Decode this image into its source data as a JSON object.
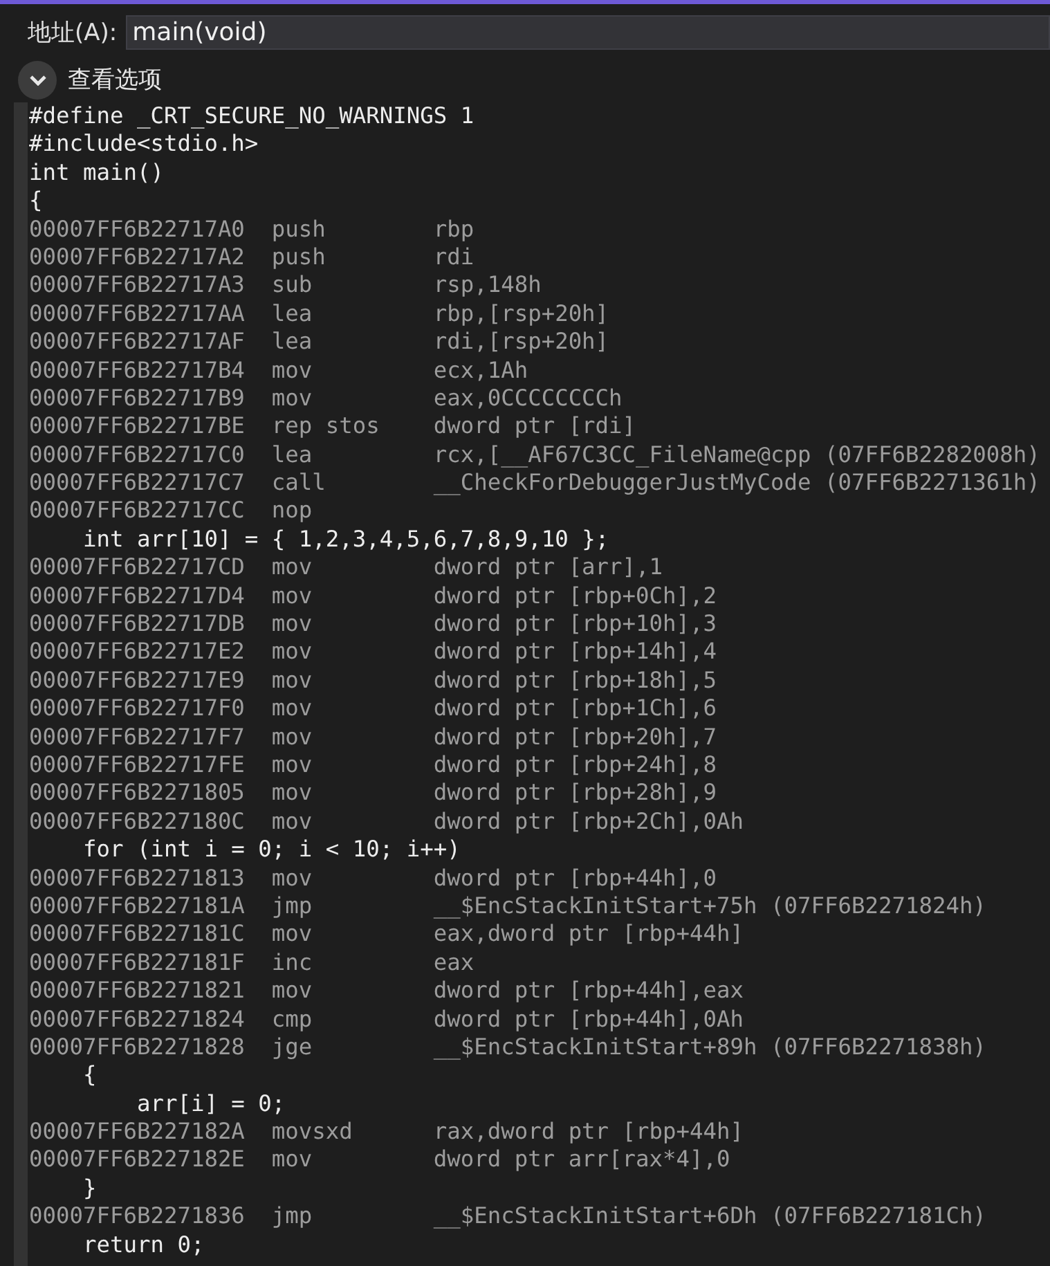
{
  "address_bar": {
    "label": "地址(A):",
    "value": "main(void)"
  },
  "view_options": {
    "label": "查看选项",
    "expanded": false
  },
  "lines": [
    {
      "kind": "source",
      "text": "#define _CRT_SECURE_NO_WARNINGS 1"
    },
    {
      "kind": "source",
      "text": "#include<stdio.h>"
    },
    {
      "kind": "source",
      "text": "int main()"
    },
    {
      "kind": "source",
      "text": "{"
    },
    {
      "kind": "asm",
      "address": "00007FF6B22717A0",
      "mnemonic": "push",
      "operands": "rbp"
    },
    {
      "kind": "asm",
      "address": "00007FF6B22717A2",
      "mnemonic": "push",
      "operands": "rdi"
    },
    {
      "kind": "asm",
      "address": "00007FF6B22717A3",
      "mnemonic": "sub",
      "operands": "rsp,148h"
    },
    {
      "kind": "asm",
      "address": "00007FF6B22717AA",
      "mnemonic": "lea",
      "operands": "rbp,[rsp+20h]"
    },
    {
      "kind": "asm",
      "address": "00007FF6B22717AF",
      "mnemonic": "lea",
      "operands": "rdi,[rsp+20h]"
    },
    {
      "kind": "asm",
      "address": "00007FF6B22717B4",
      "mnemonic": "mov",
      "operands": "ecx,1Ah"
    },
    {
      "kind": "asm",
      "address": "00007FF6B22717B9",
      "mnemonic": "mov",
      "operands": "eax,0CCCCCCCCh"
    },
    {
      "kind": "asm",
      "address": "00007FF6B22717BE",
      "mnemonic": "rep stos",
      "operands": "dword ptr [rdi]"
    },
    {
      "kind": "asm",
      "address": "00007FF6B22717C0",
      "mnemonic": "lea",
      "operands": "rcx,[__AF67C3CC_FileName@cpp (07FF6B2282008h)"
    },
    {
      "kind": "asm",
      "address": "00007FF6B22717C7",
      "mnemonic": "call",
      "operands": "__CheckForDebuggerJustMyCode (07FF6B2271361h)"
    },
    {
      "kind": "asm",
      "address": "00007FF6B22717CC",
      "mnemonic": "nop"
    },
    {
      "kind": "source",
      "text": "    int arr[10] = { 1,2,3,4,5,6,7,8,9,10 };"
    },
    {
      "kind": "asm",
      "address": "00007FF6B22717CD",
      "mnemonic": "mov",
      "operands": "dword ptr [arr],1"
    },
    {
      "kind": "asm",
      "address": "00007FF6B22717D4",
      "mnemonic": "mov",
      "operands": "dword ptr [rbp+0Ch],2"
    },
    {
      "kind": "asm",
      "address": "00007FF6B22717DB",
      "mnemonic": "mov",
      "operands": "dword ptr [rbp+10h],3"
    },
    {
      "kind": "asm",
      "address": "00007FF6B22717E2",
      "mnemonic": "mov",
      "operands": "dword ptr [rbp+14h],4"
    },
    {
      "kind": "asm",
      "address": "00007FF6B22717E9",
      "mnemonic": "mov",
      "operands": "dword ptr [rbp+18h],5"
    },
    {
      "kind": "asm",
      "address": "00007FF6B22717F0",
      "mnemonic": "mov",
      "operands": "dword ptr [rbp+1Ch],6"
    },
    {
      "kind": "asm",
      "address": "00007FF6B22717F7",
      "mnemonic": "mov",
      "operands": "dword ptr [rbp+20h],7"
    },
    {
      "kind": "asm",
      "address": "00007FF6B22717FE",
      "mnemonic": "mov",
      "operands": "dword ptr [rbp+24h],8"
    },
    {
      "kind": "asm",
      "address": "00007FF6B2271805",
      "mnemonic": "mov",
      "operands": "dword ptr [rbp+28h],9"
    },
    {
      "kind": "asm",
      "address": "00007FF6B227180C",
      "mnemonic": "mov",
      "operands": "dword ptr [rbp+2Ch],0Ah"
    },
    {
      "kind": "source",
      "text": "    for (int i = 0; i < 10; i++)"
    },
    {
      "kind": "asm",
      "address": "00007FF6B2271813",
      "mnemonic": "mov",
      "operands": "dword ptr [rbp+44h],0"
    },
    {
      "kind": "asm",
      "address": "00007FF6B227181A",
      "mnemonic": "jmp",
      "operands": "__$EncStackInitStart+75h (07FF6B2271824h)"
    },
    {
      "kind": "asm",
      "address": "00007FF6B227181C",
      "mnemonic": "mov",
      "operands": "eax,dword ptr [rbp+44h]"
    },
    {
      "kind": "asm",
      "address": "00007FF6B227181F",
      "mnemonic": "inc",
      "operands": "eax"
    },
    {
      "kind": "asm",
      "address": "00007FF6B2271821",
      "mnemonic": "mov",
      "operands": "dword ptr [rbp+44h],eax"
    },
    {
      "kind": "asm",
      "address": "00007FF6B2271824",
      "mnemonic": "cmp",
      "operands": "dword ptr [rbp+44h],0Ah"
    },
    {
      "kind": "asm",
      "address": "00007FF6B2271828",
      "mnemonic": "jge",
      "operands": "__$EncStackInitStart+89h (07FF6B2271838h)"
    },
    {
      "kind": "source",
      "text": "    {"
    },
    {
      "kind": "source",
      "text": "        arr[i] = 0;"
    },
    {
      "kind": "asm",
      "address": "00007FF6B227182A",
      "mnemonic": "movsxd",
      "operands": "rax,dword ptr [rbp+44h]"
    },
    {
      "kind": "asm",
      "address": "00007FF6B227182E",
      "mnemonic": "mov",
      "operands": "dword ptr arr[rax*4],0"
    },
    {
      "kind": "source",
      "text": "    }"
    },
    {
      "kind": "asm",
      "address": "00007FF6B2271836",
      "mnemonic": "jmp",
      "operands": "__$EncStackInitStart+6Dh (07FF6B227181Ch)"
    },
    {
      "kind": "source",
      "text": "    return 0;"
    }
  ]
}
